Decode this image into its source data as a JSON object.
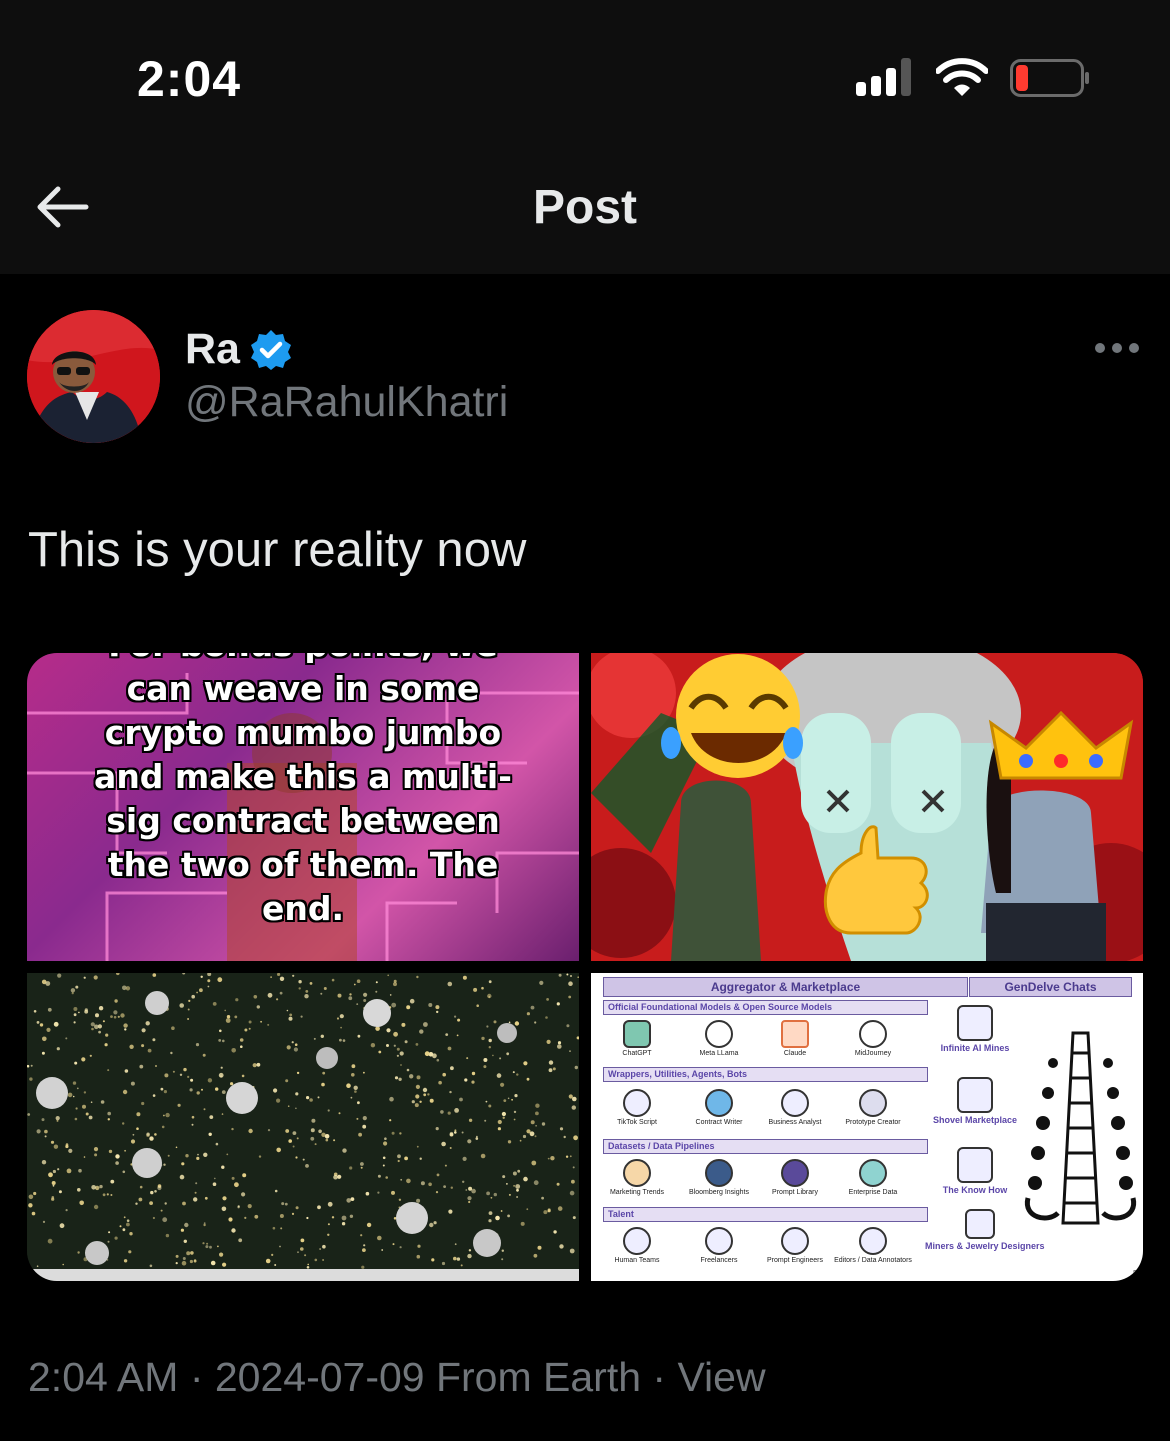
{
  "status_bar": {
    "time": "2:04"
  },
  "header": {
    "title": "Post"
  },
  "author": {
    "name": "Ra",
    "handle": "@RaRahulKhatri"
  },
  "post": {
    "text": "This is your reality now",
    "meta": "2:04 AM · 2024-07-09 From Earth · View"
  },
  "media": {
    "tile1_caption": [
      "For bonus points, we",
      "can weave in some",
      "crypto mumbo jumbo",
      "and make this a multi-",
      "sig contract between",
      "the two of them. The",
      "end."
    ],
    "infographic": {
      "header_left": "Aggregator & Marketplace",
      "header_right": "GenDelve Chats",
      "sections": [
        {
          "title": "Official Foundational Models & Open Source Models",
          "items": [
            "ChatGPT",
            "Meta LLama",
            "Claude",
            "MidJourney"
          ]
        },
        {
          "title": "Wrappers, Utilities, Agents, Bots",
          "items": [
            "TikTok Script",
            "Contract Writer",
            "Business Analyst",
            "Prototype Creator"
          ]
        },
        {
          "title": "Datasets / Data Pipelines",
          "items": [
            "Marketing Trends",
            "Bloomberg Insights",
            "Prompt Library",
            "Enterprise Data"
          ]
        },
        {
          "title": "Talent",
          "items": [
            "Human Teams",
            "Freelancers",
            "Prompt Engineers",
            "Editors / Data Annotators"
          ]
        }
      ],
      "right_items": [
        "Infinite AI Mines",
        "Shovel Marketplace",
        "The Know How",
        "Miners & Jewelry Designers"
      ],
      "page_number": "5"
    }
  },
  "colors": {
    "accent": "#1d9bf0",
    "muted": "#71767b",
    "battery_low": "#ff3b30"
  }
}
